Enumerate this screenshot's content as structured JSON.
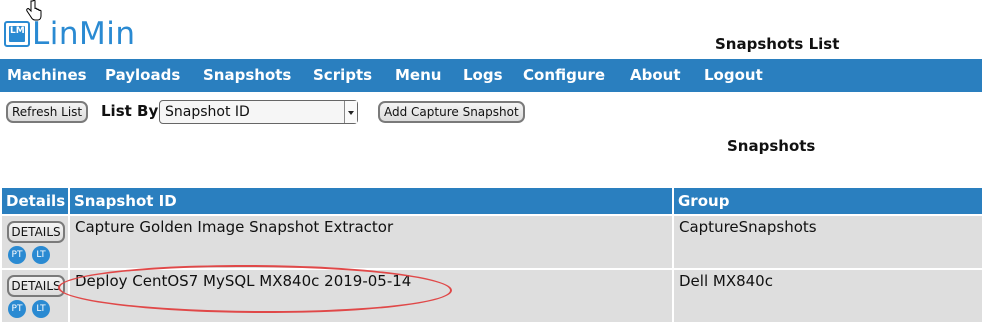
{
  "app": {
    "logo_text": "LinMin",
    "logo_mark_text": "LM",
    "page_title": "Snapshots List"
  },
  "nav": [
    {
      "label": "Machines"
    },
    {
      "label": "Payloads"
    },
    {
      "label": "Snapshots"
    },
    {
      "label": "Scripts"
    },
    {
      "label": "Menu"
    },
    {
      "label": "Logs"
    },
    {
      "label": "Configure"
    },
    {
      "label": "About"
    },
    {
      "label": "Logout"
    }
  ],
  "toolbar": {
    "refresh_label": "Refresh List",
    "listby_label": "List By",
    "listby_value": "Snapshot ID",
    "add_capture_label": "Add Capture Snapshot"
  },
  "section_title": "Snapshots",
  "table": {
    "headers": [
      "Details",
      "Snapshot ID",
      "Group"
    ],
    "rows": [
      {
        "details": "DETAILS",
        "pt": "PT",
        "lt": "LT",
        "snapshot_id": "Capture Golden Image Snapshot Extractor",
        "group": "CaptureSnapshots"
      },
      {
        "details": "DETAILS",
        "pt": "PT",
        "lt": "LT",
        "snapshot_id": "Deploy CentOS7 MySQL MX840c 2019-05-14",
        "group": "Dell MX840c"
      }
    ]
  },
  "colors": {
    "nav_bg": "#2a7fbf",
    "accent": "#2a8ad2",
    "row_bg": "#dedede",
    "annotation": "#e04848"
  }
}
